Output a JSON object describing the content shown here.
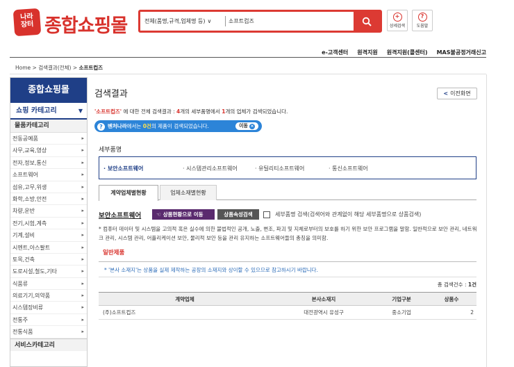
{
  "header": {
    "logo_badge": "나라\n장터",
    "logo_text": "종합쇼핑몰",
    "search_category": "전체(품명,규격,업체명 등)",
    "search_query": "소프트컵즈",
    "detail_search_label": "상세검색",
    "help_label": "도움말"
  },
  "topnav": [
    "e-고객센터",
    "원격지원",
    "원격지원(콜센터)",
    "MAS불공정거래신고"
  ],
  "breadcrumb": {
    "home": "Home",
    "sep": ">",
    "level1": "검색결과(전체)",
    "level2": "소프트컵즈"
  },
  "sidebar": {
    "title": "종합쇼핑몰",
    "category_header": "쇼핑 카테고리",
    "goods_header": "물품카테고리",
    "items": [
      "전동공예품",
      "사무,교육,영상",
      "전자,정보,통신",
      "소프트웨어",
      "섬유,고무,위생",
      "화학,소방,안전",
      "차량,운반",
      "전기,시험,계측",
      "기계,설비",
      "시멘트,아스팔트",
      "토목,건축",
      "도로시설,철도,기타",
      "식품류",
      "의료기기,의약품",
      "시스템장비류",
      "전통주",
      "전통식품"
    ],
    "service_header": "서비스카테고리"
  },
  "main": {
    "title": "검색결과",
    "back_label": "이전화면",
    "summary": {
      "q_open": "'",
      "query": "소프트컵즈",
      "q_close": "'",
      "t1": " 에 대한 전체 검색결과 : ",
      "count1": "4",
      "t2": "개의 세부품명에서 ",
      "count2": "1",
      "t3": "개의 업체가 검색되었습니다."
    },
    "venture": {
      "name": "벤처나라",
      "t1": "에서는 ",
      "count": "0건",
      "t2": "의 제품이 검색되었습니다.",
      "go": "이동"
    },
    "section_label": "세부품명",
    "subcategories": [
      {
        "label": "· 보안소프트웨어",
        "active": true
      },
      {
        "label": "· 시스템관리소프트웨어",
        "active": false
      },
      {
        "label": "· 유틸리티소프트웨어",
        "active": false
      },
      {
        "label": "· 통신소프트웨어",
        "active": false
      }
    ],
    "tabs": [
      "계약업체별현황",
      "업체소재별현황"
    ],
    "product_name": "보안소프트웨어",
    "btn_status": "상품현황으로 이동",
    "btn_attr": "상품속성검색",
    "checkbox_label": "세부품명 검색(검색어와 관계없이 해당 세부품명으로 상품검색)",
    "description": "* 컴퓨터 데이터 및 시스템을 고의적 혹은 실수에 의한 불법적인 공개, 노출, 변조, 파괴 및 지체로부터의 보호를 하기 위한 보안 프로그램을 말함. 일반적으로 보안 관리, 네트워크 관리, 시스템 관리, 어플리케이션 보안, 물리적 보안 등을 관리 유지하는 소프트웨어들의 총칭을 의미함.",
    "general_title": "일반제품",
    "note": "* '본사 소재지'는 상품을 실제 제작하는 공장의 소재지와 상이할 수 있으므로 참고하시기 바랍니다.",
    "total": {
      "label": "총 검색건수 : ",
      "count": "1건"
    },
    "table": {
      "headers": [
        "계약업체",
        "본사소재지",
        "기업구분",
        "상품수"
      ],
      "rows": [
        [
          "(주)소프트컵즈",
          "대전광역시 유성구",
          "중소기업",
          "2"
        ]
      ]
    }
  },
  "colors": {
    "brand_red": "#d8322c",
    "navy": "#1f3f87",
    "venture_blue": "#2c84d8"
  }
}
